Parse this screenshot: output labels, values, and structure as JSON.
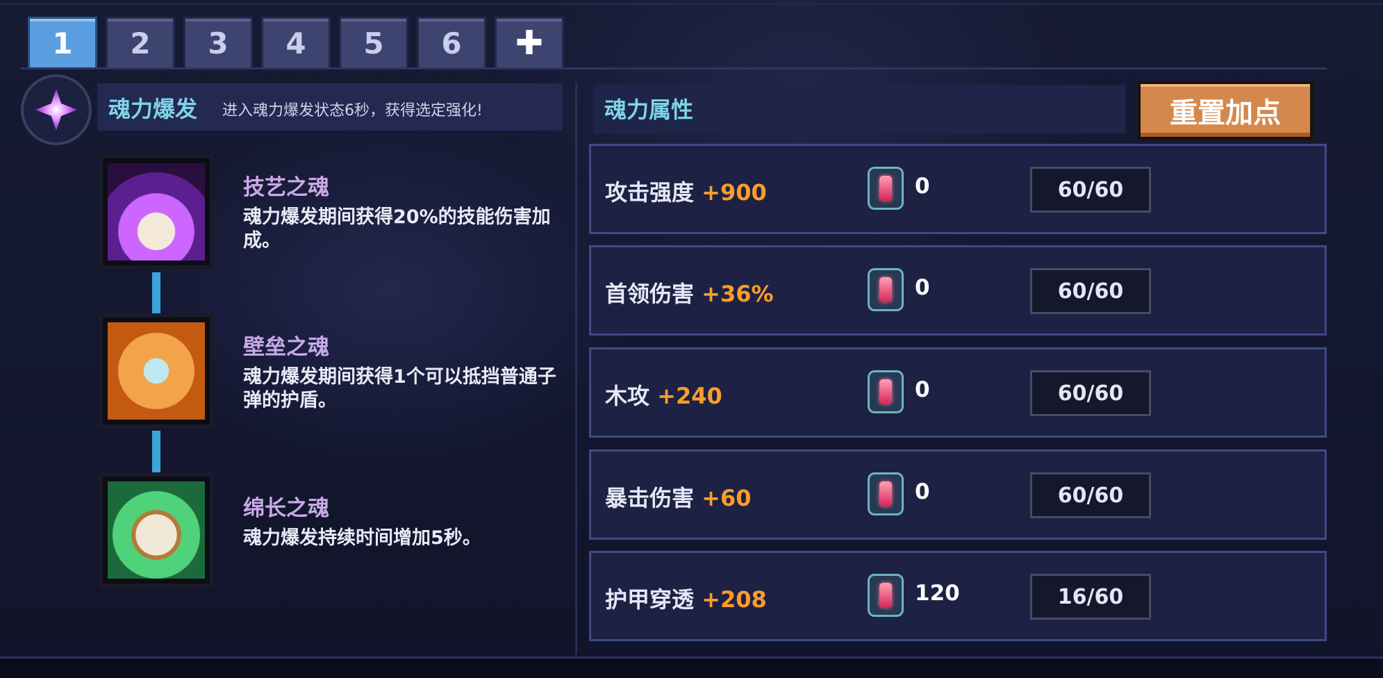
{
  "tabs": [
    {
      "label": "1",
      "active": true
    },
    {
      "label": "2",
      "active": false
    },
    {
      "label": "3",
      "active": false
    },
    {
      "label": "4",
      "active": false
    },
    {
      "label": "5",
      "active": false
    },
    {
      "label": "6",
      "active": false
    },
    {
      "label": "✚",
      "icon": "plus-icon",
      "active": false
    }
  ],
  "soul_burst": {
    "icon": "soul-burst-crystal-icon",
    "title": "魂力爆发",
    "description": "进入魂力爆发状态6秒，获得选定强化!"
  },
  "skills": [
    {
      "icon": "purple-flame-book-icon",
      "name": "技艺之魂",
      "description": "魂力爆发期间获得20%的技能伤害加成。"
    },
    {
      "icon": "shield-sword-icon",
      "name": "壁垒之魂",
      "description": "魂力爆发期间获得1个可以抵挡普通子弹的护盾。"
    },
    {
      "icon": "stopwatch-icon",
      "name": "绵长之魂",
      "description": "魂力爆发持续时间增加5秒。"
    }
  ],
  "attributes": {
    "title": "魂力属性",
    "reset_label": "重置加点",
    "rows": [
      {
        "name": "攻击强度",
        "bonus": "+900",
        "icon": "red-gem-icon",
        "gem_count": "0",
        "progress": "60/60"
      },
      {
        "name": "首领伤害",
        "bonus": "+36%",
        "icon": "red-gem-icon",
        "gem_count": "0",
        "progress": "60/60"
      },
      {
        "name": "木攻",
        "bonus": "+240",
        "icon": "red-gem-icon",
        "gem_count": "0",
        "progress": "60/60"
      },
      {
        "name": "暴击伤害",
        "bonus": "+60",
        "icon": "red-gem-icon",
        "gem_count": "0",
        "progress": "60/60"
      },
      {
        "name": "护甲穿透",
        "bonus": "+208",
        "icon": "red-gem-icon",
        "gem_count": "120",
        "progress": "16/60"
      }
    ]
  },
  "colors": {
    "active_tab": "#5a9ee0",
    "bonus": "#ff9c2a",
    "section_title": "#7fd3e8",
    "skill_name": "#c9a9e8",
    "reset_button": "#d5884c"
  }
}
